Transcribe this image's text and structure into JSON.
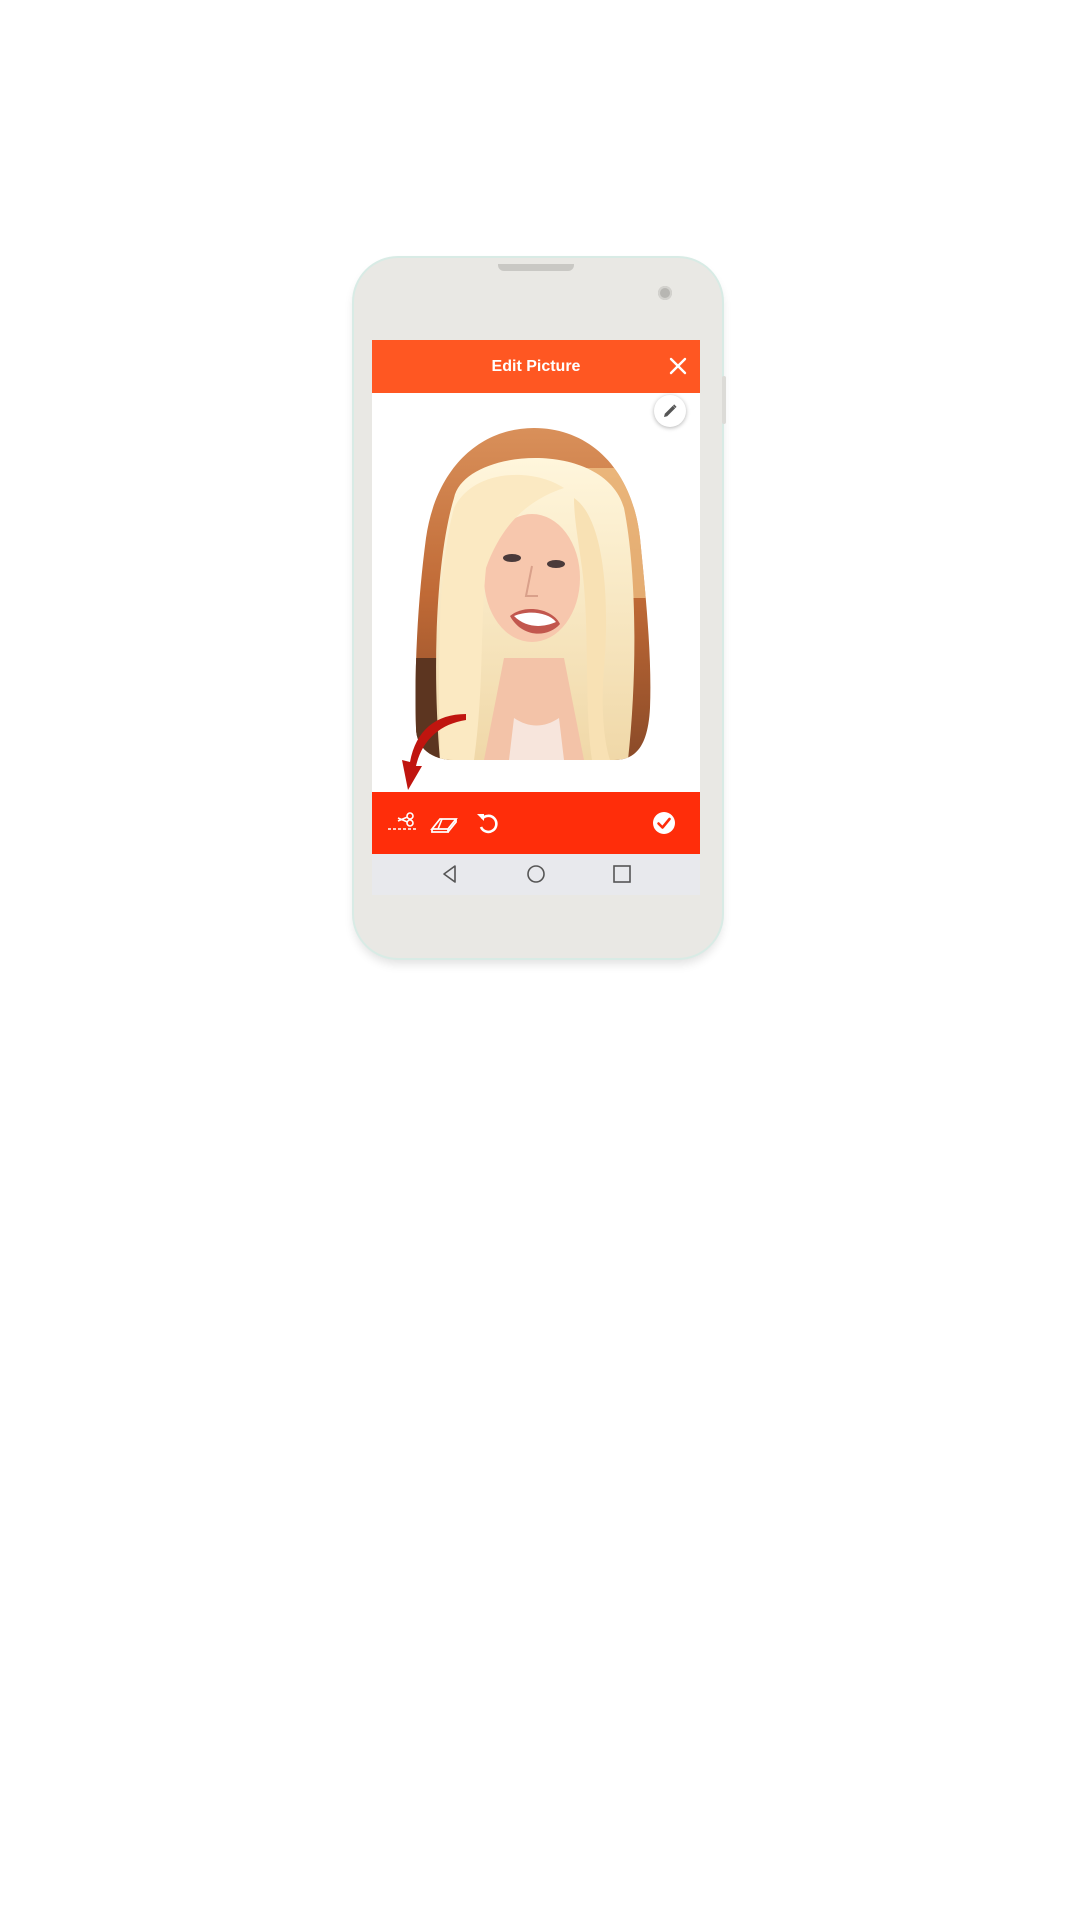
{
  "app_bar": {
    "title": "Edit Picture",
    "close_icon": "close-icon",
    "color": "#ff5722"
  },
  "edit_button": {
    "icon": "pencil-icon"
  },
  "photo": {
    "description_icon": "portrait-cutout"
  },
  "toolbar": {
    "color": "#ff2d0a",
    "tools": [
      {
        "icon": "cut-scissors-icon"
      },
      {
        "icon": "eraser-icon"
      },
      {
        "icon": "undo-icon"
      },
      {
        "icon": "check-circle-icon"
      }
    ]
  },
  "navbar": {
    "buttons": [
      {
        "icon": "back-triangle-icon"
      },
      {
        "icon": "home-circle-icon"
      },
      {
        "icon": "recents-square-icon"
      }
    ]
  }
}
